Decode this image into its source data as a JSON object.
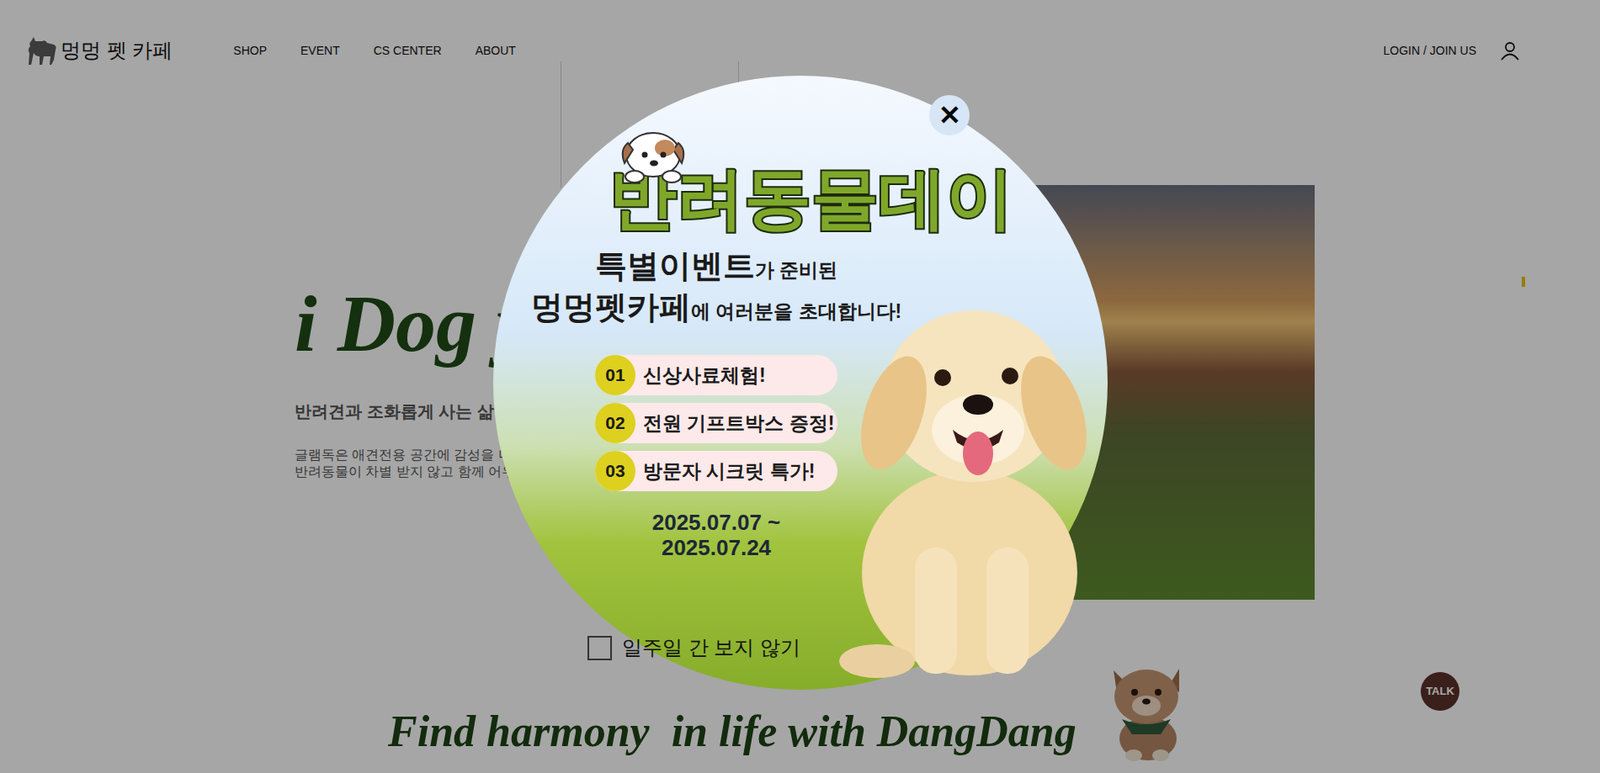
{
  "header": {
    "logo": "멍멍 펫 카페",
    "nav": [
      {
        "label": "SHOP"
      },
      {
        "label": "EVENT"
      },
      {
        "label": "CS CENTER"
      },
      {
        "label": "ABOUT"
      }
    ],
    "login": "LOGIN / JOIN US"
  },
  "hero": {
    "headline": "i Dog y",
    "subtitle": "반려견과 조화롭게 사는 삶을 끄",
    "body": [
      "글램독은 애견전용 공간에 감성을 더해",
      "반려동물이 차별 받지 않고 함께 어우러"
    ]
  },
  "banner": "Find harmony  in life with DangDang",
  "talk": "TALK",
  "popup": {
    "close": "✕",
    "title": "반려동물데이",
    "intro": [
      {
        "strong": "특별이벤트",
        "rest": "가 준비된"
      },
      {
        "strong": "멍멍펫카페",
        "rest": "에 여러분을 초대합니다!"
      }
    ],
    "events": [
      {
        "number": "01",
        "label": "신상사료체험!"
      },
      {
        "number": "02",
        "label": "전원 기프트박스 증정!"
      },
      {
        "number": "03",
        "label": "방문자 시크릿 특가!"
      }
    ],
    "dates": [
      "2025.07.07 ~",
      "2025.07.24"
    ],
    "hide_week": {
      "label": "일주일 간 보지 않기",
      "checked": false
    }
  }
}
